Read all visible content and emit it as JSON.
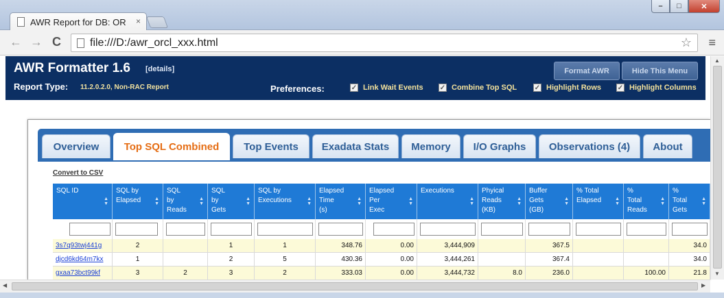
{
  "browser": {
    "tab_title": "AWR Report for DB: OR",
    "tab_close": "×",
    "url": "file:///D:/awr_orcl_xxx.html",
    "back": "←",
    "forward": "→",
    "reload": "C",
    "star": "☆",
    "menu": "≡",
    "minimize": "–",
    "maximize": "□",
    "close": "✕"
  },
  "header": {
    "title": "AWR Formatter 1.6",
    "details_link": "[details]",
    "report_type_label": "Report Type:",
    "report_type_value": "11.2.0.2.0, Non-RAC Report",
    "format_button": "Format AWR",
    "hide_button": "Hide This Menu",
    "preferences_label": "Preferences:",
    "prefs": [
      {
        "label": "Link Wait Events",
        "checked": true
      },
      {
        "label": "Combine Top SQL",
        "checked": true
      },
      {
        "label": "Highlight Rows",
        "checked": true
      },
      {
        "label": "Highlight Columns",
        "checked": true
      }
    ]
  },
  "tabs": [
    "Overview",
    "Top SQL Combined",
    "Top Events",
    "Exadata Stats",
    "Memory",
    "I/O Graphs",
    "Observations (4)",
    "About"
  ],
  "active_tab": "Top SQL Combined",
  "csv_link": "Convert to CSV",
  "table": {
    "headers": [
      [
        "",
        "",
        "SQL ID"
      ],
      [
        "",
        "SQL by",
        "Elapsed"
      ],
      [
        "SQL",
        "by",
        "Reads"
      ],
      [
        "SQL",
        "by",
        "Gets"
      ],
      [
        "",
        "SQL by",
        "Executions"
      ],
      [
        "Elapsed",
        "Time",
        "(s)"
      ],
      [
        "Elapsed",
        "Per",
        "Exec"
      ],
      [
        "",
        "",
        "Executions"
      ],
      [
        "Phyical",
        "Reads",
        "(KB)"
      ],
      [
        "Buffer",
        "Gets",
        "(GB)"
      ],
      [
        "",
        "% Total",
        "Elapsed"
      ],
      [
        "%",
        "Total",
        "Reads"
      ],
      [
        "%",
        "Total",
        "Gets"
      ]
    ],
    "rows": [
      [
        "3s7q93twj441g",
        "2",
        "",
        "1",
        "1",
        "348.76",
        "0.00",
        "3,444,909",
        "",
        "367.5",
        "",
        "",
        "34.0"
      ],
      [
        "djcd6kd64m7kx",
        "1",
        "",
        "2",
        "5",
        "430.36",
        "0.00",
        "3,444,261",
        "",
        "367.4",
        "",
        "",
        "34.0"
      ],
      [
        "gxaa73bct99kf",
        "3",
        "2",
        "3",
        "2",
        "333.03",
        "0.00",
        "3,444,732",
        "8.0",
        "236.0",
        "",
        "100.00",
        "21.8"
      ]
    ]
  }
}
